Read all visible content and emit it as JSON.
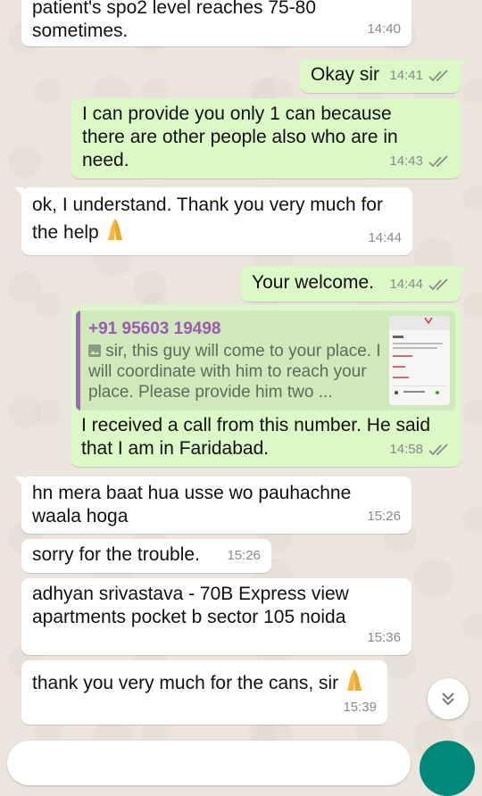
{
  "messages": [
    {
      "text": "patient's spo2 level reaches 75-80 sometimes.",
      "time": "14:40"
    },
    {
      "text": "Okay sir",
      "time": "14:41"
    },
    {
      "text": "I can provide you only 1 can because there are other people also who are in need.",
      "time": "14:43"
    },
    {
      "text": "ok, I understand. Thank you very much for the help",
      "time": "14:44"
    },
    {
      "text": "Your welcome.",
      "time": "14:44"
    },
    {
      "quote_name": "+91 95603 19498",
      "quote_text": "sir, this guy will come to your place. I will coordinate with him to reach your place.  Please provide him two ...",
      "text": "I received a call from this number. He said that I am in Faridabad.",
      "time": "14:58"
    },
    {
      "text": "hn mera baat hua usse wo pauhachne waala hoga",
      "time": "15:26"
    },
    {
      "text": "sorry for the trouble.",
      "time": "15:26"
    },
    {
      "text": "adhyan srivastava - 70B Express view apartments pocket b sector 105 noida",
      "time": "15:36"
    },
    {
      "text": "thank you very much for the cans, sir",
      "time": "15:39"
    }
  ],
  "colors": {
    "outgoing_bubble": "#dcf8c6",
    "incoming_bubble": "#ffffff",
    "read_ticks": "#8a8a8a",
    "quote_name": "#9b59b6",
    "send_button": "#00897b"
  },
  "icons": {
    "read_receipt": "double-check-icon",
    "emoji": "folded-hands-icon",
    "quote_media": "image-icon",
    "scroll": "chevron-double-down-icon"
  }
}
